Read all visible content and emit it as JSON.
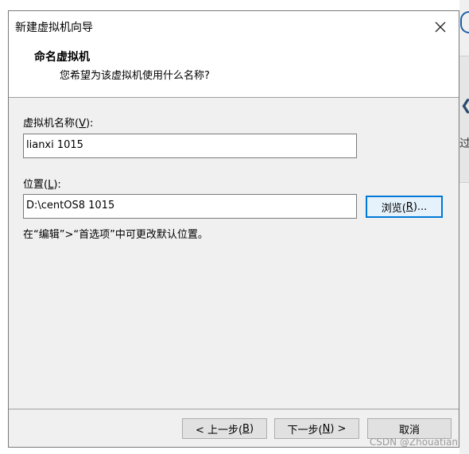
{
  "dialog": {
    "title": "新建虚拟机向导",
    "header": {
      "title": "命名虚拟机",
      "subtitle": "您希望为该虚拟机使用什么名称?"
    }
  },
  "form": {
    "vm_name_label_prefix": "虚拟机名称(",
    "vm_name_label_key": "V",
    "vm_name_label_suffix": "):",
    "vm_name_value": "lianxi 1015",
    "location_label_prefix": "位置(",
    "location_label_key": "L",
    "location_label_suffix": "):",
    "location_value": "D:\\centOS8 1015",
    "browse_prefix": "浏览(",
    "browse_key": "R",
    "browse_suffix": ")...",
    "hint": "在“编辑”>“首选项”中可更改默认位置。"
  },
  "buttons": {
    "back_prefix": "< 上一步(",
    "back_key": "B",
    "back_suffix": ")",
    "next_prefix": "下一步(",
    "next_key": "N",
    "next_suffix": ") >",
    "cancel": "取消"
  },
  "background": {
    "partial_char": "过"
  },
  "watermark": "CSDN @Zhouatian",
  "colors": {
    "dialog_bg": "#f0f0f0",
    "header_bg": "#ffffff",
    "focus_border": "#0078d7"
  }
}
